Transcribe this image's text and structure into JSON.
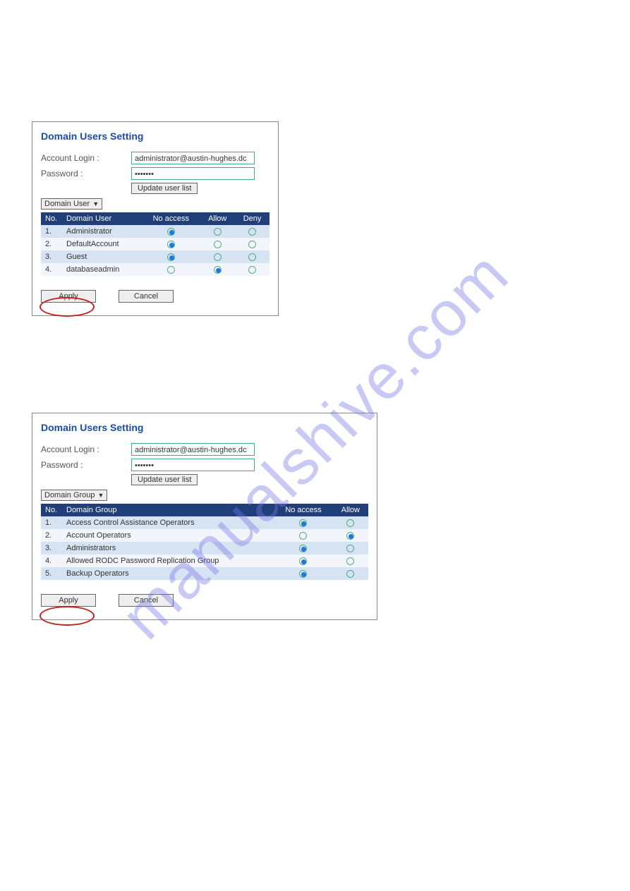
{
  "watermark": "manualshive.com",
  "panel1": {
    "title": "Domain Users Setting",
    "account_label": "Account Login :",
    "account_value": "administrator@austin-hughes.dc",
    "password_label": "Password :",
    "password_value": "•••••••",
    "update_btn": "Update user list",
    "select_value": "Domain User",
    "headers": {
      "no": "No.",
      "name": "Domain User",
      "c1": "No access",
      "c2": "Allow",
      "c3": "Deny"
    },
    "rows": [
      {
        "n": "1.",
        "name": "Administrator",
        "sel": 0
      },
      {
        "n": "2.",
        "name": "DefaultAccount",
        "sel": 0
      },
      {
        "n": "3.",
        "name": "Guest",
        "sel": 0
      },
      {
        "n": "4.",
        "name": "databaseadmin",
        "sel": 1
      }
    ],
    "apply": "Apply",
    "cancel": "Cancel"
  },
  "panel2": {
    "title": "Domain Users Setting",
    "account_label": "Account Login :",
    "account_value": "administrator@austin-hughes.dc",
    "password_label": "Password :",
    "password_value": "•••••••",
    "update_btn": "Update user list",
    "select_value": "Domain Group",
    "headers": {
      "no": "No.",
      "name": "Domain Group",
      "c1": "No access",
      "c2": "Allow"
    },
    "rows": [
      {
        "n": "1.",
        "name": "Access Control Assistance Operators",
        "sel": 0
      },
      {
        "n": "2.",
        "name": "Account Operators",
        "sel": 1
      },
      {
        "n": "3.",
        "name": "Administrators",
        "sel": 0
      },
      {
        "n": "4.",
        "name": "Allowed RODC Password Replication Group",
        "sel": 0
      },
      {
        "n": "5.",
        "name": "Backup Operators",
        "sel": 0
      }
    ],
    "apply": "Apply",
    "cancel": "Cancel"
  }
}
